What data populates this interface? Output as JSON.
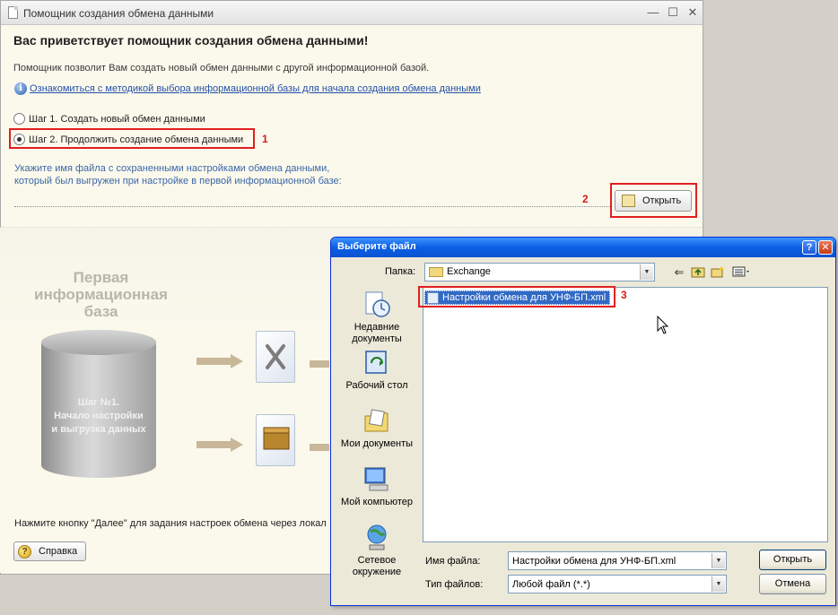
{
  "main_window": {
    "title": "Помощник создания обмена данными",
    "controls": {
      "minimize": "—",
      "maximize": "☐",
      "close": "✕"
    },
    "heading": "Вас приветствует помощник создания обмена данными!",
    "description": "Помощник позволит Вам создать новый обмен данными с другой информационной базой.",
    "info_link": "Ознакомиться с методикой выбора информационной базы для начала создания обмена данными",
    "step1_label": "Шаг 1. Создать новый обмен данными",
    "step2_label": "Шаг 2. Продолжить создание обмена данными",
    "file_hint_line1": "Укажите имя файла с сохраненными настройками обмена данными,",
    "file_hint_line2": "который был выгружен при настройке в первой информационной базе:",
    "file_path_value": "",
    "open_button": "Открыть",
    "db_label_line1": "Первая",
    "db_label_line2": "информационная",
    "db_label_line3": "база",
    "db_step_line1": "Шаг №1.",
    "db_step_line2": "Начало настройки",
    "db_step_line3": "и выгрузка данных",
    "bottom_hint": "Нажмите кнопку \"Далее\" для задания настроек обмена через локал",
    "help_button": "Справка"
  },
  "annotations": {
    "n1": "1",
    "n2": "2",
    "n3": "3"
  },
  "dialog": {
    "title": "Выберите файл",
    "help_btn": "?",
    "close_btn": "✕",
    "folder_label": "Папка:",
    "folder_value": "Exchange",
    "places": [
      {
        "label_line1": "Недавние",
        "label_line2": "документы"
      },
      {
        "label_line1": "Рабочий стол",
        "label_line2": ""
      },
      {
        "label_line1": "Мои документы",
        "label_line2": ""
      },
      {
        "label_line1": "Мой компьютер",
        "label_line2": ""
      },
      {
        "label_line1": "Сетевое",
        "label_line2": "окружение"
      }
    ],
    "file_item": "Настройки обмена для УНФ-БП.xml",
    "filename_label": "Имя файла:",
    "filename_value": "Настройки обмена для УНФ-БП.xml",
    "filetype_label": "Тип файлов:",
    "filetype_value": "Любой файл (*.*)",
    "open_button": "Открыть",
    "cancel_button": "Отмена"
  },
  "colors": {
    "accent_red": "#e0201f",
    "xp_blue": "#0a53d4",
    "selection": "#316ac5",
    "link": "#2250a8"
  }
}
